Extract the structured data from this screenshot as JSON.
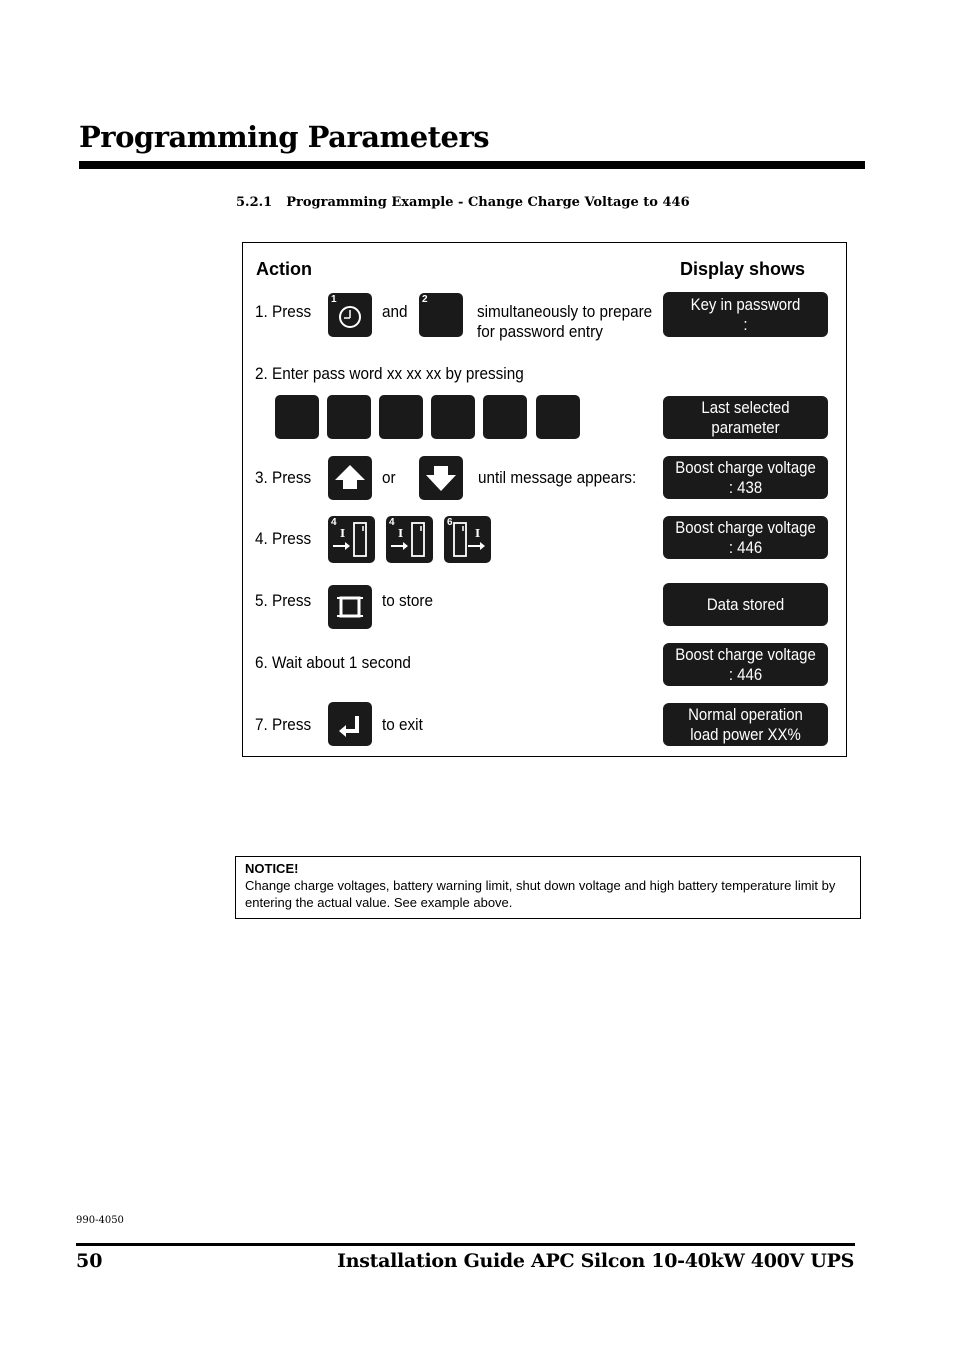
{
  "page": {
    "title": "Programming Parameters",
    "section_number": "5.2.1",
    "section_title": "Programming Example - Change Charge Voltage to 446"
  },
  "figure": {
    "action_header": "Action",
    "display_header": "Display shows",
    "steps": [
      {
        "prefix": "1. Press",
        "between": "and",
        "suffix_line1": "simultaneously to prepare",
        "suffix_line2": "for password entry",
        "keys": [
          "clock-key-1",
          "key-2"
        ]
      },
      {
        "text": "2. Enter pass word xx xx xx by pressing",
        "keys": [
          "key",
          "key",
          "key",
          "key",
          "key",
          "key"
        ]
      },
      {
        "prefix": "3. Press",
        "between": "or",
        "suffix": "until message appears:",
        "keys": [
          "up-arrow-key",
          "down-arrow-key"
        ]
      },
      {
        "prefix": "4. Press",
        "keys": [
          "key-4",
          "key-4",
          "key-6"
        ]
      },
      {
        "prefix": "5. Press",
        "suffix": "to store",
        "keys": [
          "store-key"
        ]
      },
      {
        "text": "6. Wait about 1 second"
      },
      {
        "prefix": "7. Press",
        "suffix": "to exit",
        "keys": [
          "enter-key"
        ]
      }
    ],
    "key_numbers": {
      "k1": "1",
      "k2": "2",
      "k4a": "4",
      "k4b": "4",
      "k6": "6"
    },
    "displays": [
      {
        "line1": "Key in password",
        "line2": ":"
      },
      {
        "line1": "Last selected",
        "line2": "parameter"
      },
      {
        "line1": "Boost charge voltage",
        "line2": ": 438"
      },
      {
        "line1": "Boost charge voltage",
        "line2": ": 446"
      },
      {
        "line1": "Data stored",
        "line2": ""
      },
      {
        "line1": "Boost charge voltage",
        "line2": ": 446"
      },
      {
        "line1": "Normal operation",
        "line2": "load power XX%"
      }
    ]
  },
  "notice": {
    "title": "NOTICE!",
    "body": "Change charge voltages, battery warning limit, shut down voltage and high battery temperature limit by entering the actual value. See example above."
  },
  "footer": {
    "doc_number": "990-4050",
    "page_number": "50",
    "title": "Installation Guide APC Silcon 10-40kW 400V UPS"
  }
}
